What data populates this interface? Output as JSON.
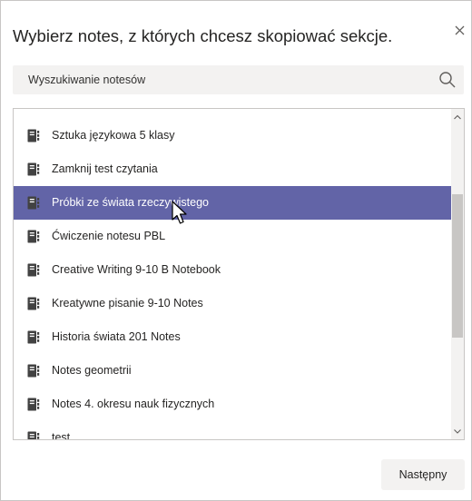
{
  "dialog": {
    "title": "Wybierz notes, z których chcesz skopiować sekcje.",
    "close_icon": "close-icon"
  },
  "search": {
    "placeholder": "Wyszukiwanie notesów",
    "icon": "search-icon"
  },
  "list": {
    "item_icon": "notebook-icon",
    "selected_index": 2,
    "items": [
      {
        "label": "Sztuka językowa 5 klasy"
      },
      {
        "label": "Zamknij test czytania"
      },
      {
        "label": "Próbki ze świata rzeczywistego"
      },
      {
        "label": "Ćwiczenie notesu PBL"
      },
      {
        "label": "Creative Writing 9-10 B Notebook"
      },
      {
        "label": "Kreatywne pisanie 9-10 Notes"
      },
      {
        "label": "Historia świata 201 Notes"
      },
      {
        "label": "Notes geometrii"
      },
      {
        "label": "Notes 4. okresu nauk fizycznych"
      },
      {
        "label": "test"
      }
    ]
  },
  "footer": {
    "next_label": "Następny"
  },
  "colors": {
    "selected_row": "#6264a7",
    "button_bg": "#f3f2f1",
    "icon": "#424242"
  }
}
